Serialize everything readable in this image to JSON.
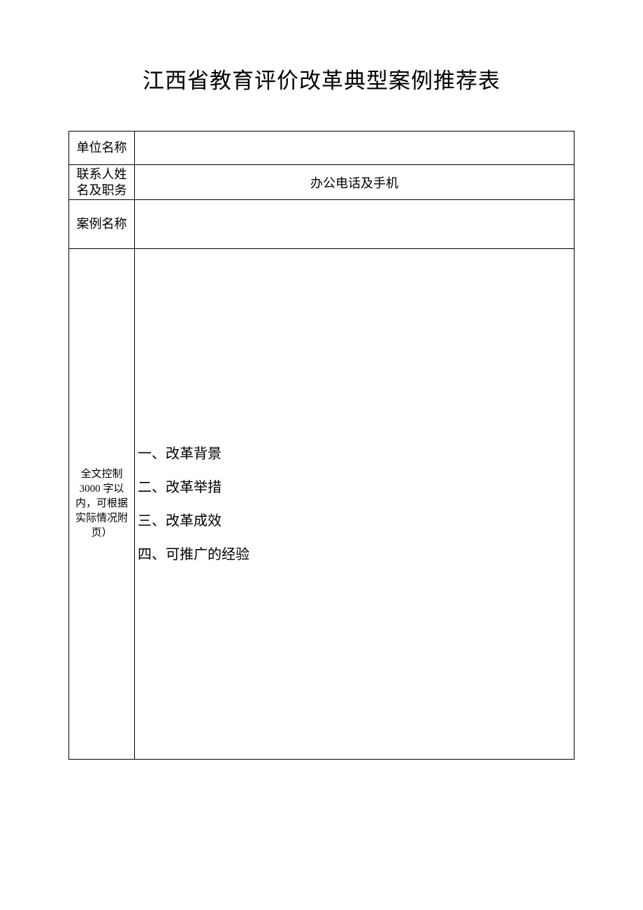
{
  "title": "江西省教育评价改革典型案例推荐表",
  "rows": {
    "r1": {
      "label": "单位名称",
      "value": ""
    },
    "r2": {
      "label": "联系人姓名及职务",
      "value": "办公电话及手机"
    },
    "r3": {
      "label": "案例名称",
      "value": ""
    },
    "r4": {
      "label": "全文控制3000 字以内，可根据实际情况附页）",
      "lines": {
        "l1": "一、改革背景",
        "l2": "二、改革举措",
        "l3": "三、改革成效",
        "l4": "四、可推广的经验"
      }
    }
  }
}
